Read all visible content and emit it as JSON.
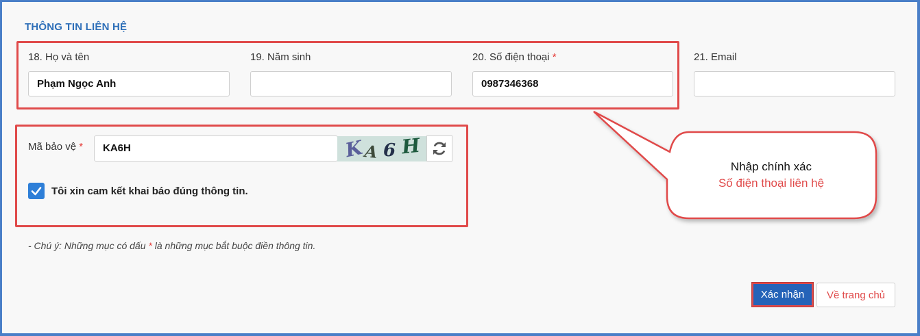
{
  "section": {
    "title": "THÔNG TIN LIÊN HỆ"
  },
  "fields": {
    "name": {
      "label": "18. Họ và tên",
      "value": "Phạm Ngọc Anh"
    },
    "birth_year": {
      "label": "19. Năm sinh",
      "value": ""
    },
    "phone": {
      "label": "20. Số điện thoại",
      "required": "*",
      "value": "0987346368"
    },
    "email": {
      "label": "21. Email",
      "value": ""
    }
  },
  "captcha": {
    "label": "Mã bảo vệ",
    "required": "*",
    "value": "KA6H",
    "image_chars": [
      "K",
      "A",
      "6",
      "H"
    ],
    "refresh_icon": "refresh-icon"
  },
  "commitment": {
    "checked": true,
    "text": "Tôi xin cam kết khai báo đúng thông tin."
  },
  "note": {
    "prefix": "- Chú ý: Những mục có dấu ",
    "star": "*",
    "suffix": " là những mục bắt buộc điền thông tin."
  },
  "callout": {
    "line1": "Nhập chính xác",
    "line2": "Số điện thoại liên hệ"
  },
  "buttons": {
    "confirm": "Xác nhận",
    "home": "Về trang chủ"
  },
  "colors": {
    "accent": "#2e6fb8",
    "primary_button": "#2563b8",
    "highlight": "#e04a4a",
    "checkbox": "#2e7fd8"
  }
}
